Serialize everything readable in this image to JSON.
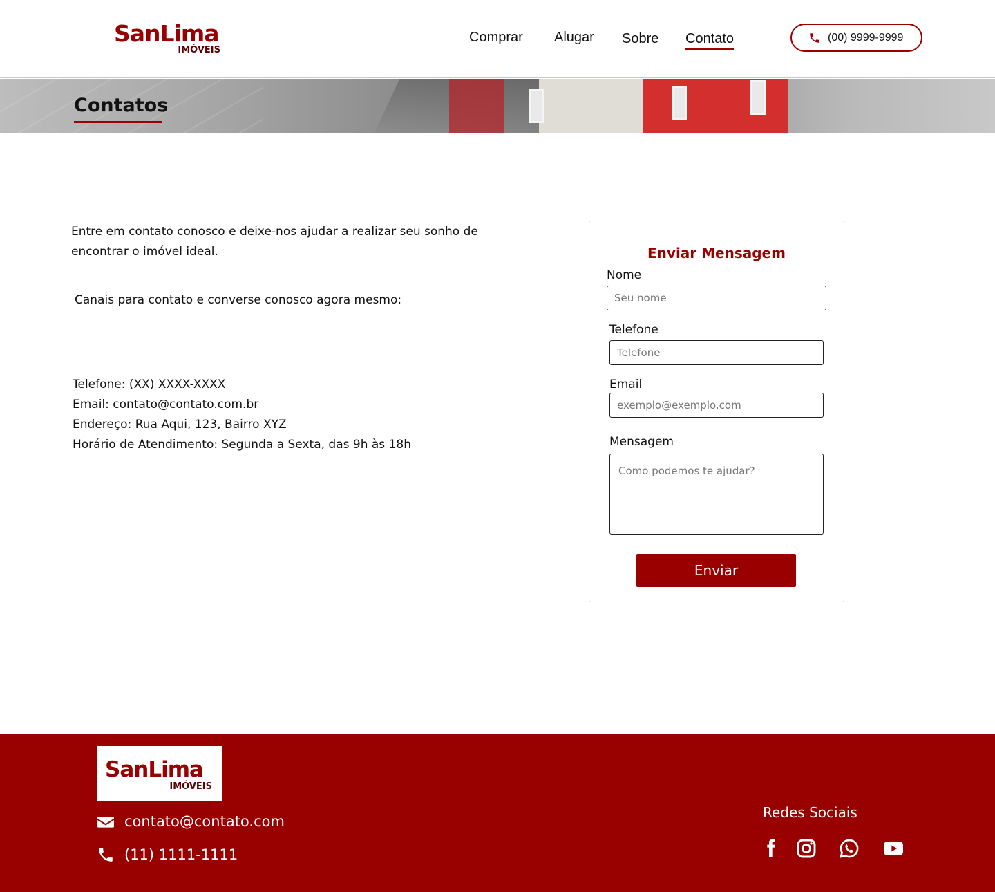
{
  "header": {
    "logo_brand": "SanLima",
    "logo_sub": "IMÓVEIS",
    "nav": [
      "Comprar",
      "Alugar",
      "Sobre",
      "Contato"
    ],
    "active_nav": "Contato",
    "phone": "(00) 9999-9999"
  },
  "hero": {
    "title": "Contatos"
  },
  "content": {
    "intro": "Entre em contato conosco e deixe-nos ajudar a realizar seu sonho de encontrar o imóvel ideal.",
    "channels": "Canais para contato e converse conosco agora mesmo:",
    "info": [
      "Telefone: (XX) XXXX-XXXX",
      "Email: contato@contato.com.br",
      "Endereço: Rua Aqui, 123, Bairro XYZ",
      "Horário de Atendimento: Segunda a Sexta, das 9h às 18h"
    ]
  },
  "form": {
    "title": "Enviar Mensagem",
    "name_label": "Nome",
    "name_placeholder": "Seu nome",
    "phone_label": "Telefone",
    "phone_placeholder": "Telefone",
    "email_label": "Email",
    "email_placeholder": "exemplo@exemplo.com",
    "message_label": "Mensagem",
    "message_placeholder": "Como podemos te ajudar?",
    "submit": "Enviar"
  },
  "footer": {
    "logo_brand": "SanLima",
    "logo_sub": "IMÓVEIS",
    "email": "contato@contato.com",
    "phone": "(11) 1111-1111",
    "social_title": "Redes Sociais",
    "social": [
      "facebook-icon",
      "instagram-icon",
      "whatsapp-icon",
      "youtube-icon"
    ]
  },
  "colors": {
    "brand": "#9b0000",
    "footer_bg": "#990000"
  }
}
